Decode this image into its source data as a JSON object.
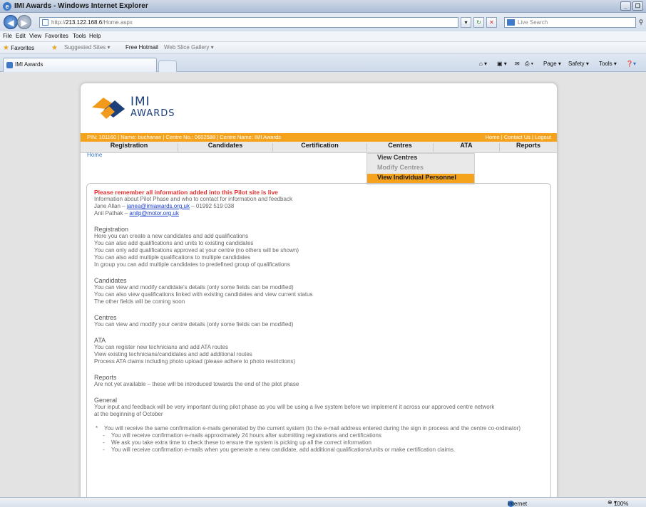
{
  "window": {
    "title": "IMI Awards - Windows Internet Explorer",
    "minimize": "_",
    "maximize": "❐"
  },
  "address": {
    "prefix": "http://",
    "host": "213.122.168.6",
    "path": "/Home.aspx",
    "search_placeholder": "Live Search"
  },
  "menu": [
    "File",
    "Edit",
    "View",
    "Favorites",
    "Tools",
    "Help"
  ],
  "favorites": {
    "label": "Favorites",
    "suggested": "Suggested Sites ▾",
    "hotmail": "Free Hotmail",
    "gallery": "Web Slice Gallery ▾"
  },
  "tab": {
    "title": "IMI Awards"
  },
  "command_bar": {
    "page": "Page ▾",
    "safety": "Safety ▾",
    "tools": "Tools ▾"
  },
  "site": {
    "logo_top": "IMI",
    "logo_bottom": "AWARDS",
    "infobar_left": "PIN: 101160  |  Name: buchanan  |  Centre No.: 0602588  |  Centre Name: IMI Awards",
    "infobar_links": {
      "home": "Home",
      "contact": "Contact Us",
      "logout": "Logout",
      "sep": "|"
    },
    "nav": [
      "Registration",
      "Candidates",
      "Certification",
      "Centres",
      "ATA",
      "Reports"
    ],
    "dropdown": {
      "view": "View Centres",
      "modify": "Modify Centres",
      "individual": "View Individual Personnel"
    },
    "breadcrumb": "Home"
  },
  "content": {
    "alert": "Please remember all information added into this Pilot site is live",
    "intro": "Information about Pilot Phase and who to contact for information and feedback",
    "contact1_name": "Jane Allan – ",
    "contact1_email": "janea@imiawards.org.uk",
    "contact1_phone": " – 01992 519 038",
    "contact2_name": "Anil Pathak – ",
    "contact2_email": "anilp@motor.org.uk",
    "sections": [
      {
        "heading": "Registration",
        "lines": [
          "Here you can create a new candidates and add qualifications",
          "You can also add qualifications and units to existing candidates",
          "You can only add qualifications approved at your centre (no others will be shown)",
          "You can also add multiple qualifications to multiple candidates",
          "In group you can add multiple candidates to predefined group of qualifications"
        ]
      },
      {
        "heading": "Candidates",
        "lines": [
          "You can view and modify candidate's details (only some fields can be modified)",
          "You can also view qualifications linked with existing candidates and view current status",
          "The other fields will be coming soon"
        ]
      },
      {
        "heading": "Centres",
        "lines": [
          "You can view and modify your centre details (only some fields can be modified)"
        ]
      },
      {
        "heading": "ATA",
        "lines": [
          "You can register new technicians and add ATA routes",
          "View existing technicians/candidates and add additional routes",
          "Process ATA claims including photo upload (please adhere to photo restrictions)"
        ]
      },
      {
        "heading": "Reports",
        "lines": [
          "Are not yet available – these will be introduced towards the end of the pilot phase"
        ]
      },
      {
        "heading": "General",
        "lines": [
          "Your input and feedback will be very important during pilot phase as you will be using a live system before we implement it across our approved centre network",
          "at the beginning of October"
        ]
      }
    ],
    "bullet_main": "You will receive the same confirmation e-mails generated by the current system (to the e-mail address entered during the sign in process and  the centre co-ordinator)",
    "bullet_subs": [
      "You will receive confirmation e-mails approximately 24 hours after submitting registrations and certifications",
      "We ask you take extra time to check these to ensure the system is picking up all the correct information",
      "You will receive confirmation e-mails when you generate a new candidate, add additional qualifications/units or make certification claims."
    ]
  },
  "status": {
    "zone": "Internet",
    "zoom": "100%"
  },
  "colors": {
    "orange": "#f5a31c",
    "alert_red": "#e62c2c",
    "link_blue": "#1c3fcf",
    "logo_blue": "#1d3f7a"
  }
}
